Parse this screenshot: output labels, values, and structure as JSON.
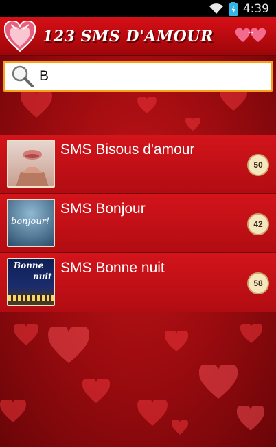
{
  "status_bar": {
    "time": "4:39"
  },
  "header": {
    "title": "123 SMS D'AMOUR"
  },
  "search": {
    "value": "B"
  },
  "list": {
    "items": [
      {
        "label": "SMS Bisous d'amour",
        "count": "50"
      },
      {
        "label": "SMS Bonjour",
        "count": "42"
      },
      {
        "label": "SMS Bonne nuit",
        "count": "58"
      }
    ]
  },
  "thumbnails": {
    "bonjour_text": "bonjour!",
    "bonne_nuit_text_1": "Bonne",
    "bonne_nuit_text_2": "nuit"
  },
  "colors": {
    "accent": "#f7a11a",
    "header": "#d60f17",
    "row": "#c11017"
  },
  "icons": [
    "wifi-icon",
    "battery-icon",
    "heart-box-logo",
    "heart-glasses-icon",
    "search-icon"
  ]
}
